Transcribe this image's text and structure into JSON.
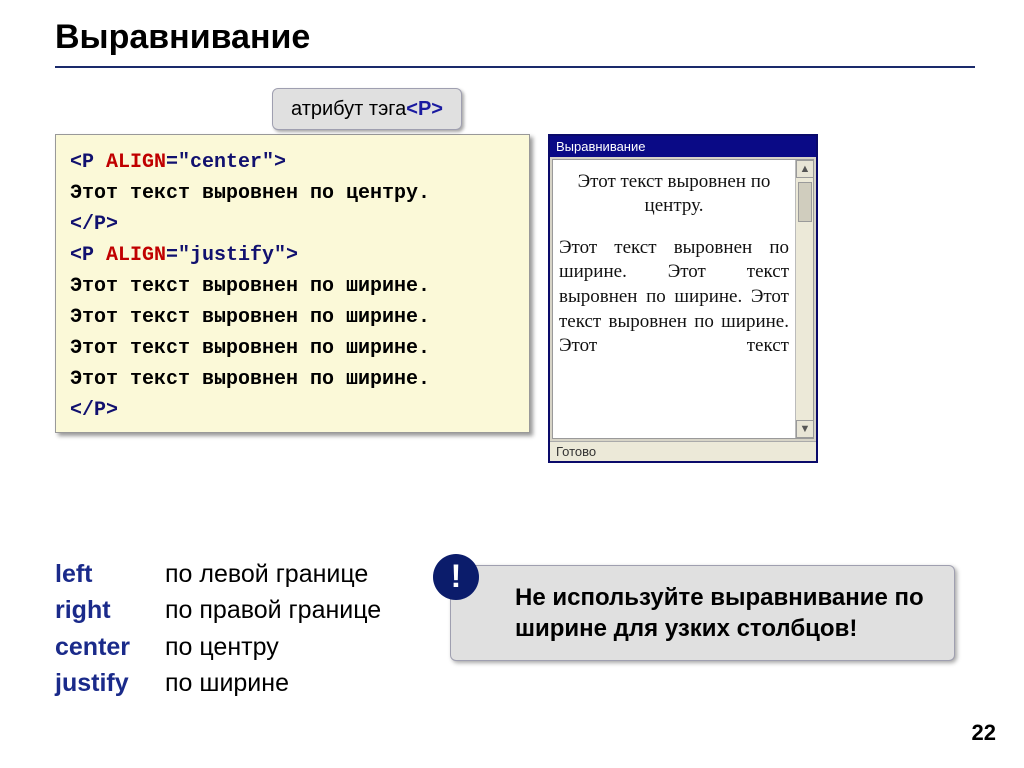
{
  "title": "Выравнивание",
  "callout": {
    "prefix": "атрибут тэга ",
    "tag_open": "<",
    "tag_name": "P",
    "tag_close": ">"
  },
  "code": {
    "l1_open": "<P ",
    "l1_attr": "ALIGN",
    "l1_rest": "=\"center\">",
    "l2": "Этот текст выровнен по центру.",
    "l3": "</P>",
    "l4_open": "<P ",
    "l4_attr": "ALIGN",
    "l4_rest": "=\"justify\">",
    "l5": "Этот текст выровнен по ширине.",
    "l6": "Этот текст выровнен по ширине.",
    "l7": "Этот текст выровнен по ширине.",
    "l8": "Этот текст выровнен по ширине.",
    "l9": "</P>"
  },
  "browser": {
    "title": "Выравнивание",
    "centered": "Этот текст выровнен по центру.",
    "justified": "Этот текст выровнен по ширине. Этот текст выровнен по ширине. Этот текст выровнен по ширине. Этот текст",
    "status": "Готово"
  },
  "alignments": [
    {
      "kw": "left",
      "desc": "по левой границе"
    },
    {
      "kw": "right",
      "desc": "по правой границе"
    },
    {
      "kw": "center",
      "desc": "по центру"
    },
    {
      "kw": "justify",
      "desc": "по ширине"
    }
  ],
  "warning": {
    "badge": "!",
    "text": "Не используйте выравнивание по ширине для узких столбцов!"
  },
  "page_number": "22"
}
